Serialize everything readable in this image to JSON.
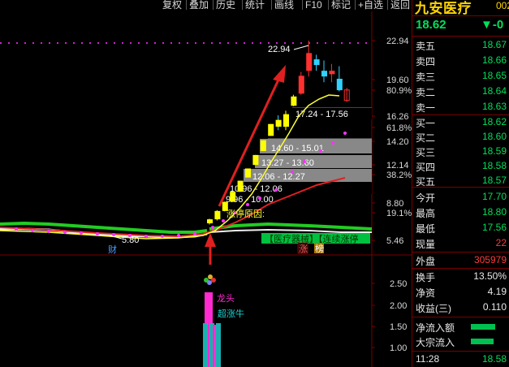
{
  "toolbar": {
    "buttons": [
      "复权",
      "叠加",
      "历史",
      "统计",
      "画线",
      "F10",
      "标记",
      "+自选",
      "返回"
    ]
  },
  "stock": {
    "name": "九安医疗",
    "code": "002",
    "price": "18.62",
    "change": "▼-0"
  },
  "order_book": {
    "asks": [
      {
        "label": "卖五",
        "price": "18.67"
      },
      {
        "label": "卖四",
        "price": "18.66"
      },
      {
        "label": "卖三",
        "price": "18.65"
      },
      {
        "label": "卖二",
        "price": "18.64"
      },
      {
        "label": "卖一",
        "price": "18.63"
      }
    ],
    "bids": [
      {
        "label": "买一",
        "price": "18.62"
      },
      {
        "label": "买二",
        "price": "18.60"
      },
      {
        "label": "买三",
        "price": "18.59"
      },
      {
        "label": "买四",
        "price": "18.58"
      },
      {
        "label": "买五",
        "price": "18.57"
      }
    ]
  },
  "quote_stats": [
    {
      "label": "今开",
      "value": "17.70",
      "color": "green"
    },
    {
      "label": "最高",
      "value": "18.80",
      "color": "green"
    },
    {
      "label": "最低",
      "value": "17.56",
      "color": "green"
    },
    {
      "label": "现量",
      "value": "22",
      "color": "red"
    }
  ],
  "outer_volume": {
    "label": "外盘",
    "value": "305979"
  },
  "metrics": [
    {
      "label": "换手",
      "value": "13.50%"
    },
    {
      "label": "净资",
      "value": "4.19"
    },
    {
      "label": "收益(三)",
      "value": "0.110"
    }
  ],
  "flows": [
    {
      "label": "净流入额"
    },
    {
      "label": "大宗流入"
    }
  ],
  "last_tick": {
    "time": "11:28",
    "price": "18.58"
  },
  "price_axis": {
    "labels": [
      "22.94",
      "19.60",
      "80.9%",
      "16.26",
      "61.8%",
      "14.20",
      "12.14",
      "38.2%",
      "8.80",
      "19.1%",
      "5.46"
    ]
  },
  "indicator_axis": {
    "labels": [
      "2.50",
      "2.00",
      "1.50",
      "1.00"
    ]
  },
  "annotations": {
    "high": "22.94",
    "low": "5.80",
    "zones": [
      "17.24 - 17.56",
      "14.60 - 15.01",
      "13.27 - 13.60",
      "12.06 - 12.27",
      "10.96 - 12.06",
      "9.96 - 10.00"
    ],
    "limit_reason": "涨停原因:",
    "concept_tag": "【医疗器械】【连续涨停",
    "marker_cai": "财",
    "marker_zhang": "涨",
    "marker_bang": "榜",
    "longtou": "龙头",
    "chaozhangniu": "超涨牛"
  },
  "chart_data": {
    "type": "candlestick",
    "candles": [
      {
        "o": 6.95,
        "h": 7.35,
        "l": 6.85,
        "c": 7.3
      },
      {
        "o": 7.3,
        "h": 8.1,
        "l": 7.2,
        "c": 8.03
      },
      {
        "o": 8.03,
        "h": 8.85,
        "l": 8.0,
        "c": 8.83
      },
      {
        "o": 8.83,
        "h": 9.71,
        "l": 8.83,
        "c": 9.71
      },
      {
        "o": 9.71,
        "h": 10.68,
        "l": 9.71,
        "c": 10.68
      },
      {
        "o": 10.96,
        "h": 11.75,
        "l": 10.96,
        "c": 11.75
      },
      {
        "o": 12.06,
        "h": 12.93,
        "l": 12.06,
        "c": 12.93
      },
      {
        "o": 13.27,
        "h": 14.22,
        "l": 13.27,
        "c": 14.22
      },
      {
        "o": 14.6,
        "h": 15.64,
        "l": 14.6,
        "c": 15.64
      },
      {
        "o": 16.0,
        "h": 16.4,
        "l": 15.1,
        "c": 15.4
      },
      {
        "o": 15.4,
        "h": 16.8,
        "l": 15.1,
        "c": 16.5
      },
      {
        "o": 17.24,
        "h": 18.2,
        "l": 17.2,
        "c": 18.05
      },
      {
        "o": 18.3,
        "h": 20.2,
        "l": 18.2,
        "c": 19.86
      },
      {
        "o": 20.3,
        "h": 22.94,
        "l": 19.8,
        "c": 21.85
      },
      {
        "o": 21.3,
        "h": 21.7,
        "l": 20.3,
        "c": 20.8
      },
      {
        "o": 20.3,
        "h": 21.2,
        "l": 19.3,
        "c": 19.8
      },
      {
        "o": 20.0,
        "h": 20.9,
        "l": 19.3,
        "c": 20.3
      },
      {
        "o": 19.6,
        "h": 20.7,
        "l": 18.5,
        "c": 18.6
      },
      {
        "o": 17.7,
        "h": 18.8,
        "l": 17.56,
        "c": 18.62
      }
    ]
  }
}
